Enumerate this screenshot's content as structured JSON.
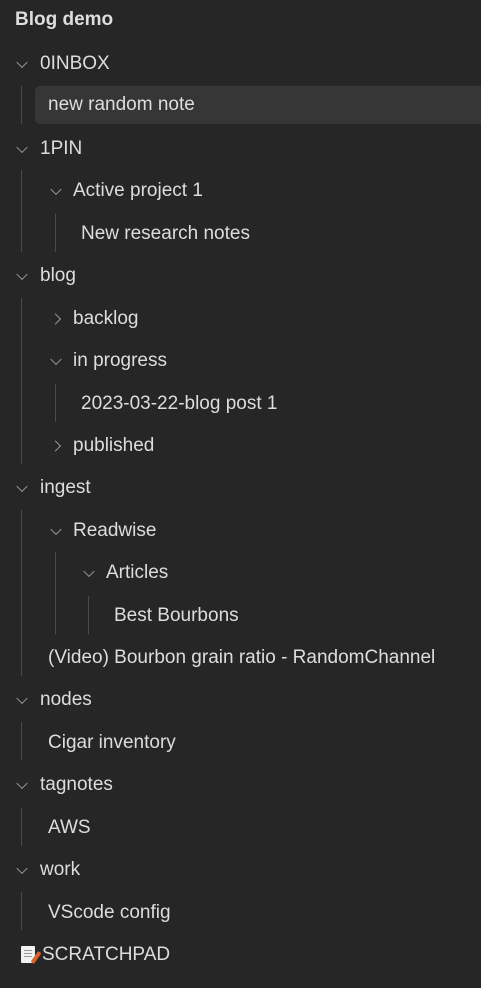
{
  "vault": {
    "title": "Blog demo"
  },
  "tree": {
    "inbox": {
      "label": "0INBOX",
      "new_random_note": "new random note"
    },
    "pin": {
      "label": "1PIN",
      "active_project": {
        "label": "Active project 1",
        "new_research_notes": "New research notes"
      }
    },
    "blog": {
      "label": "blog",
      "backlog": "backlog",
      "in_progress": {
        "label": "in progress",
        "post1": "2023-03-22-blog post 1"
      },
      "published": "published"
    },
    "ingest": {
      "label": "ingest",
      "readwise": {
        "label": "Readwise",
        "articles": {
          "label": "Articles",
          "best_bourbons": "Best Bourbons"
        }
      },
      "video_note": "(Video) Bourbon grain ratio - RandomChannel"
    },
    "nodes": {
      "label": "nodes",
      "cigar_inventory": "Cigar inventory"
    },
    "tagnotes": {
      "label": "tagnotes",
      "aws": "AWS"
    },
    "work": {
      "label": "work",
      "vscode_config": "VScode config"
    },
    "scratchpad": {
      "label": "SCRATCHPAD",
      "icon": "memo-icon"
    }
  },
  "colors": {
    "background": "#262626",
    "selected_row": "#363636",
    "text": "#dcddde",
    "guide_line": "#4a4a4a"
  }
}
